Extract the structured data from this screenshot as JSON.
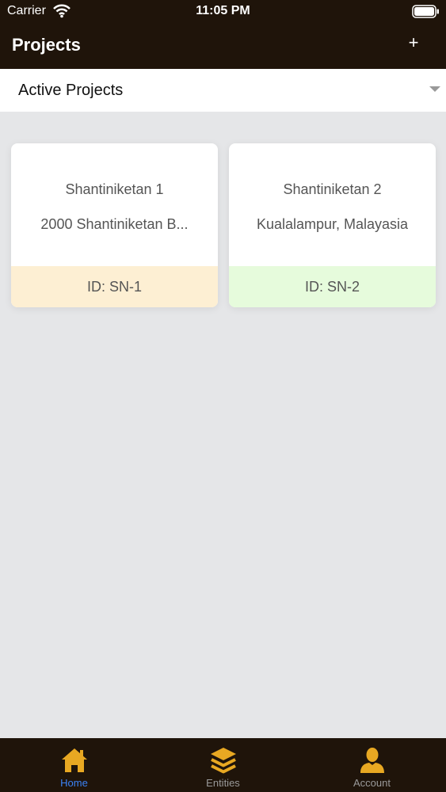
{
  "status_bar": {
    "carrier": "Carrier",
    "time": "11:05 PM",
    "wifi_icon": "wifi-icon",
    "battery_icon": "battery-icon"
  },
  "header": {
    "title": "Projects",
    "add_label": "+"
  },
  "filter": {
    "selected": "Active Projects",
    "arrow_icon": "chevron-down-icon"
  },
  "projects": [
    {
      "name": "Shantiniketan 1",
      "address": "2000 Shantiniketan B...",
      "id_label": "ID: SN-1",
      "footer_color": "#fdefd3"
    },
    {
      "name": "Shantiniketan 2",
      "address": "Kualalampur, Malayasia",
      "id_label": "ID: SN-2",
      "footer_color": "#e6fbdc"
    }
  ],
  "tabs": [
    {
      "label": "Home",
      "icon": "home-icon",
      "active": true
    },
    {
      "label": "Entities",
      "icon": "layers-icon",
      "active": false
    },
    {
      "label": "Account",
      "icon": "user-icon",
      "active": false
    }
  ],
  "colors": {
    "bar_background": "#1f140a",
    "page_background": "#e5e6e8",
    "icon_accent": "#e8a822",
    "tab_active_text": "#3b82f6",
    "tab_inactive_text": "#9a9a9a"
  }
}
